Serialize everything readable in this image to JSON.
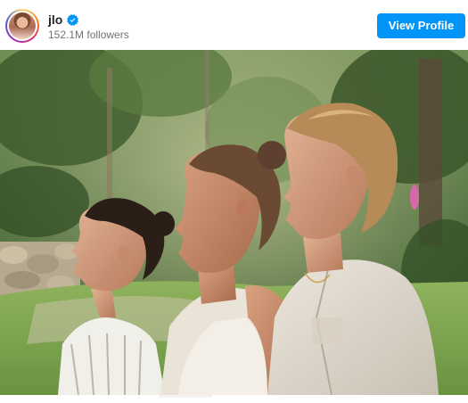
{
  "profile": {
    "username": "jlo",
    "followers": "152.1M followers",
    "verified": true,
    "avatar_icon": "profile-avatar",
    "verified_icon": "verified-badge-icon"
  },
  "actions": {
    "view_profile_label": "View Profile"
  },
  "colors": {
    "accent": "#0095f6",
    "text_primary": "#262626",
    "text_secondary": "#737373"
  },
  "photo": {
    "subject": "three women in profile in a garden"
  }
}
